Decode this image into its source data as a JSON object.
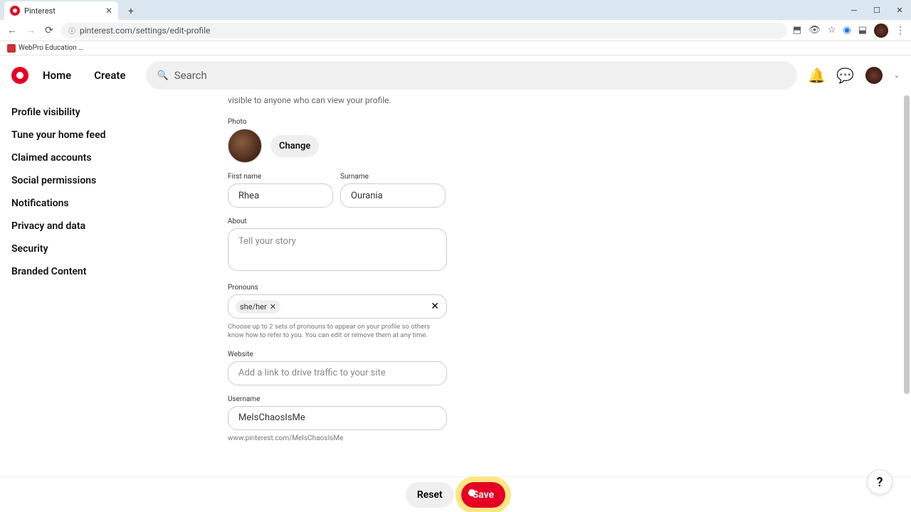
{
  "browser": {
    "tab_title": "Pinterest",
    "url": "pinterest.com/settings/edit-profile",
    "bookmark": "WebPro Education …"
  },
  "header": {
    "home": "Home",
    "create": "Create",
    "search_placeholder": "Search"
  },
  "sidebar": {
    "items": [
      "Profile visibility",
      "Tune your home feed",
      "Claimed accounts",
      "Social permissions",
      "Notifications",
      "Privacy and data",
      "Security",
      "Branded Content"
    ]
  },
  "form": {
    "hint_tail": "visible to anyone who can view your profile.",
    "photo_label": "Photo",
    "change_label": "Change",
    "first_name_label": "First name",
    "first_name_value": "Rhea",
    "surname_label": "Surname",
    "surname_value": "Ourania",
    "about_label": "About",
    "about_placeholder": "Tell your story",
    "pronouns_label": "Pronouns",
    "pronoun_chip": "she/her",
    "pronouns_help": "Choose up to 2 sets of pronouns to appear on your profile so others know how to refer to you. You can edit or remove them at any time.",
    "website_label": "Website",
    "website_placeholder": "Add a link to drive traffic to your site",
    "username_label": "Username",
    "username_value": "MeIsChaosIsMe",
    "username_url": "www.pinterest.com/MeIsChaosIsMe"
  },
  "footer": {
    "reset": "Reset",
    "save": "Save"
  },
  "fab": "?"
}
